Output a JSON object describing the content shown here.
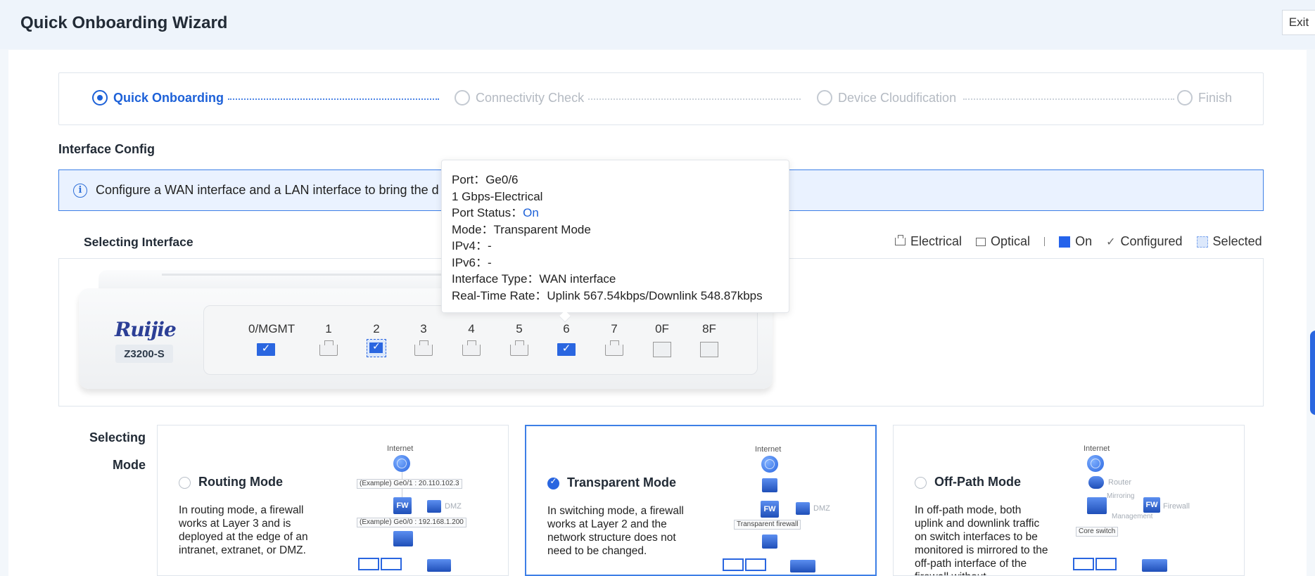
{
  "header": {
    "title": "Quick Onboarding Wizard",
    "exit_label": "Exit"
  },
  "steps": [
    {
      "label": "Quick Onboarding",
      "active": true
    },
    {
      "label": "Connectivity Check",
      "active": false
    },
    {
      "label": "Device Cloudification",
      "active": false
    },
    {
      "label": "Finish",
      "active": false
    }
  ],
  "interface_config": {
    "title": "Interface Config",
    "info": "Configure a WAN interface and a LAN interface to bring the d"
  },
  "selecting_interface": {
    "title": "Selecting Interface",
    "legend": {
      "electrical": "Electrical",
      "optical": "Optical",
      "separator": "|",
      "on": "On",
      "configured": "Configured",
      "selected": "Selected"
    }
  },
  "device": {
    "brand": "Ruijie",
    "model": "Z3200-S",
    "ports": [
      {
        "label": "0/MGMT",
        "type": "electrical",
        "state": "on"
      },
      {
        "label": "1",
        "type": "electrical",
        "state": "off"
      },
      {
        "label": "2",
        "type": "electrical",
        "state": "selected"
      },
      {
        "label": "3",
        "type": "electrical",
        "state": "off"
      },
      {
        "label": "4",
        "type": "electrical",
        "state": "off"
      },
      {
        "label": "5",
        "type": "electrical",
        "state": "off"
      },
      {
        "label": "6",
        "type": "electrical",
        "state": "on"
      },
      {
        "label": "7",
        "type": "electrical",
        "state": "off"
      },
      {
        "label": "0F",
        "type": "optical",
        "state": "off"
      },
      {
        "label": "8F",
        "type": "optical",
        "state": "off"
      }
    ]
  },
  "tooltip": {
    "port_key": "Port：",
    "port_val": "Ge0/6",
    "speed": "1 Gbps-Electrical",
    "status_key": "Port Status：",
    "status_val": "On",
    "mode_key": "Mode：",
    "mode_val": "Transparent Mode",
    "ipv4_key": "IPv4：",
    "ipv4_val": "-",
    "ipv6_key": "IPv6：",
    "ipv6_val": "-",
    "type_key": "Interface Type：",
    "type_val": "WAN interface",
    "rate_key": "Real-Time Rate：",
    "rate_val": "Uplink 567.54kbps/Downlink 548.87kbps"
  },
  "selecting_mode": {
    "label_line1": "Selecting",
    "label_line2": "Mode",
    "modes": [
      {
        "name": "Routing Mode",
        "selected": false,
        "desc": "In routing mode, a firewall works at Layer 3 and is deployed at the edge of an intranet, extranet, or DMZ.",
        "diagram": {
          "internet": "Internet",
          "tag1": "(Example) Ge0/1 : 20.110.102.3",
          "dmz": "DMZ",
          "tag2": "(Example)  Ge0/0 : 192.168.1.200",
          "fw": "FW"
        }
      },
      {
        "name": "Transparent Mode",
        "selected": true,
        "desc": "In switching mode, a firewall works at Layer 2 and the network structure does not need to be changed.",
        "diagram": {
          "internet": "Internet",
          "dmz": "DMZ",
          "tag1": "Transparent firewall",
          "fw": "FW"
        }
      },
      {
        "name": "Off-Path Mode",
        "selected": false,
        "desc": "In off-path mode, both uplink and downlink traffic on switch interfaces to be monitored is mirrored to the off-path interface of the firewall without",
        "diagram": {
          "internet": "Internet",
          "router": "Router",
          "mirroring": "Mirroring",
          "firewall": "Firewall",
          "management": "Management",
          "tag1": "Core switch",
          "fw": "FW"
        }
      }
    ]
  },
  "colors": {
    "accent": "#1d61d8",
    "port_on": "#2a66e0",
    "info_bg": "#eaf2ff"
  }
}
